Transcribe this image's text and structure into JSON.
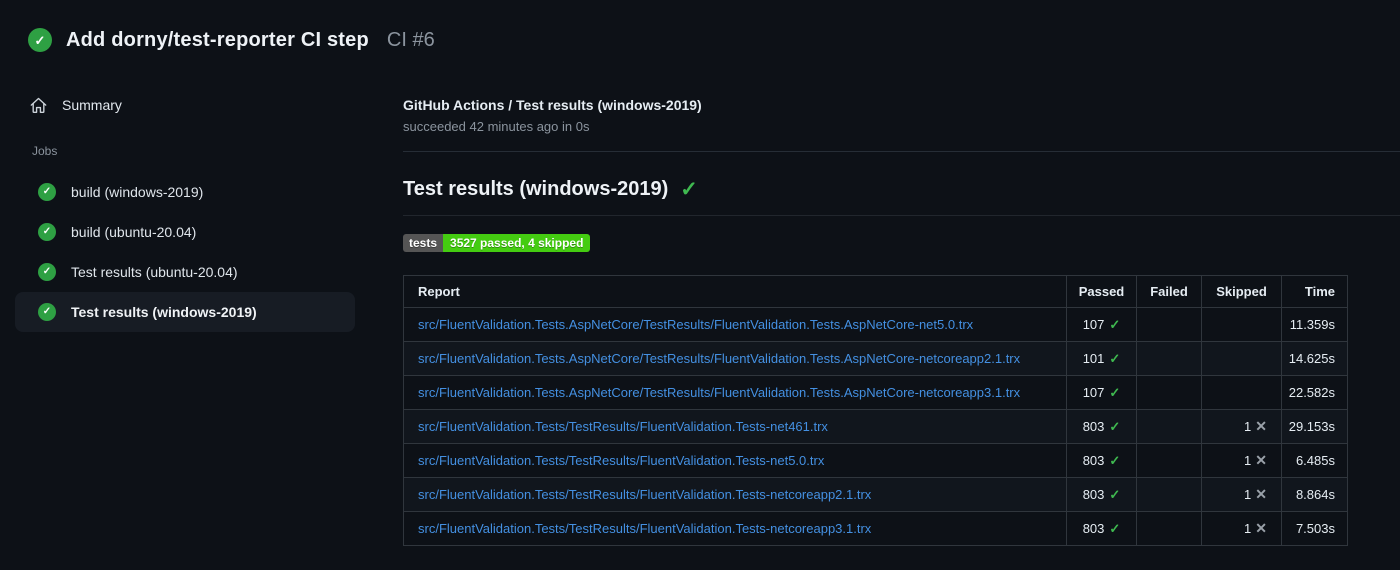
{
  "icons": {
    "check": "✓",
    "cross": "✕"
  },
  "colors": {
    "background": "#0d1117",
    "status_green": "#2ea043",
    "check_green": "#3fb950",
    "link_blue": "#4490e2",
    "badge_label_bg": "#555555",
    "badge_value_bg": "#44cc11",
    "secondary_text": "#8b949e",
    "table_border": "#30363d"
  },
  "header": {
    "title": "Add dorny/test-reporter CI step",
    "run_number": "CI #6"
  },
  "sidebar": {
    "summary_label": "Summary",
    "jobs_label": "Jobs",
    "jobs": [
      {
        "label": "build (windows-2019)",
        "status": "success",
        "selected": false
      },
      {
        "label": "build (ubuntu-20.04)",
        "status": "success",
        "selected": false
      },
      {
        "label": "Test results (ubuntu-20.04)",
        "status": "success",
        "selected": false
      },
      {
        "label": "Test results (windows-2019)",
        "status": "success",
        "selected": true
      }
    ]
  },
  "main": {
    "breadcrumb": "GitHub Actions / Test results (windows-2019)",
    "status_line": "succeeded 42 minutes ago in 0s",
    "heading": "Test results (windows-2019)",
    "badge": {
      "label": "tests",
      "value": "3527 passed, 4 skipped"
    },
    "table": {
      "headers": [
        "Report",
        "Passed",
        "Failed",
        "Skipped",
        "Time"
      ],
      "rows": [
        {
          "report": "src/FluentValidation.Tests.AspNetCore/TestResults/FluentValidation.Tests.AspNetCore-net5.0.trx",
          "passed": "107",
          "failed": "",
          "skipped": "",
          "time": "11.359s"
        },
        {
          "report": "src/FluentValidation.Tests.AspNetCore/TestResults/FluentValidation.Tests.AspNetCore-netcoreapp2.1.trx",
          "passed": "101",
          "failed": "",
          "skipped": "",
          "time": "14.625s"
        },
        {
          "report": "src/FluentValidation.Tests.AspNetCore/TestResults/FluentValidation.Tests.AspNetCore-netcoreapp3.1.trx",
          "passed": "107",
          "failed": "",
          "skipped": "",
          "time": "22.582s"
        },
        {
          "report": "src/FluentValidation.Tests/TestResults/FluentValidation.Tests-net461.trx",
          "passed": "803",
          "failed": "",
          "skipped": "1",
          "time": "29.153s"
        },
        {
          "report": "src/FluentValidation.Tests/TestResults/FluentValidation.Tests-net5.0.trx",
          "passed": "803",
          "failed": "",
          "skipped": "1",
          "time": "6.485s"
        },
        {
          "report": "src/FluentValidation.Tests/TestResults/FluentValidation.Tests-netcoreapp2.1.trx",
          "passed": "803",
          "failed": "",
          "skipped": "1",
          "time": "8.864s"
        },
        {
          "report": "src/FluentValidation.Tests/TestResults/FluentValidation.Tests-netcoreapp3.1.trx",
          "passed": "803",
          "failed": "",
          "skipped": "1",
          "time": "7.503s"
        }
      ]
    }
  }
}
